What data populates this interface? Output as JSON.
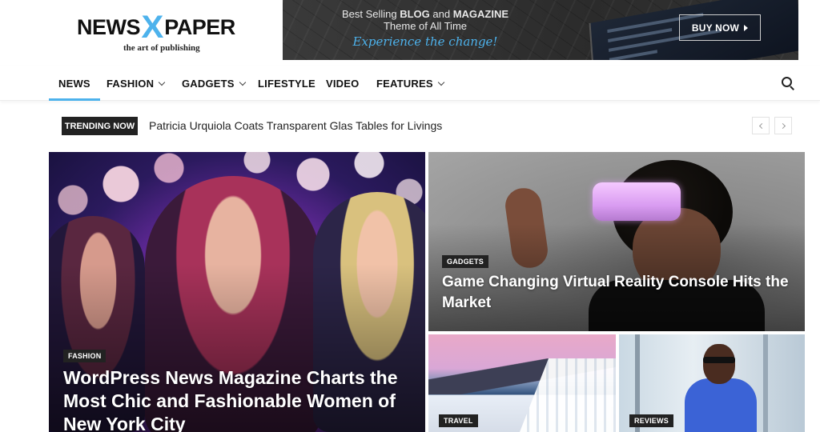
{
  "logo": {
    "part1": "NEWS",
    "part2": "X",
    "part3": "PAPER",
    "tagline": "the art of publishing"
  },
  "banner": {
    "line1_pre": "Best Selling ",
    "line1_b1": "BLOG",
    "line1_mid": " and ",
    "line1_b2": "MAGAZINE",
    "line2": "Theme of All Time",
    "line3": "Experience the change!",
    "button": "BUY NOW"
  },
  "nav": {
    "items": [
      {
        "label": "NEWS",
        "dropdown": false,
        "active": true
      },
      {
        "label": "FASHION",
        "dropdown": true
      },
      {
        "label": "GADGETS",
        "dropdown": true
      },
      {
        "label": "LIFESTYLE",
        "dropdown": false
      },
      {
        "label": "VIDEO",
        "dropdown": false
      },
      {
        "label": "FEATURES",
        "dropdown": true
      }
    ],
    "search_icon": "search-icon"
  },
  "trending": {
    "label": "TRENDING NOW",
    "text": "Patricia Urquiola Coats Transparent Glas Tables for Livings"
  },
  "tiles": [
    {
      "category": "FASHION",
      "title": "WordPress News Magazine Charts the Most Chic and Fashionable Women of New York City"
    },
    {
      "category": "GADGETS",
      "title": "Game Changing Virtual Reality Console Hits the Market"
    },
    {
      "category": "TRAVEL",
      "title": ""
    },
    {
      "category": "REVIEWS",
      "title": ""
    }
  ],
  "colors": {
    "accent": "#4db2ec",
    "dark": "#222222"
  }
}
